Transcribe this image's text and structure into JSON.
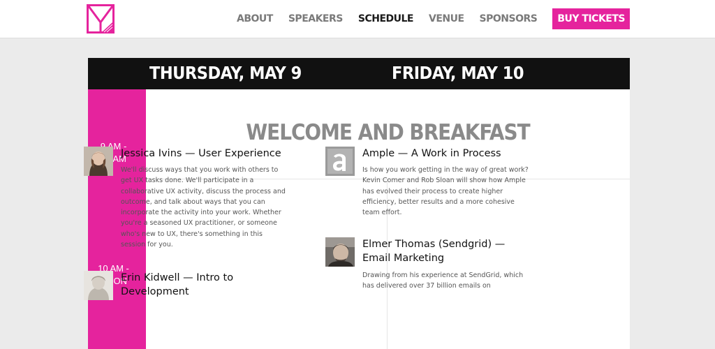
{
  "nav": {
    "items": [
      "ABOUT",
      "SPEAKERS",
      "SCHEDULE",
      "VENUE",
      "SPONSORS"
    ],
    "active": "SCHEDULE",
    "cta": "BUY TICKETS"
  },
  "colors": {
    "accent": "#e5239d",
    "header_black": "#111111",
    "muted_heading": "#8a8a8a"
  },
  "icons": {
    "logo": "m-monogram-logo-icon"
  },
  "schedule": {
    "days": [
      "THURSDAY, MAY 9",
      "FRIDAY, MAY 10"
    ],
    "slots": [
      {
        "line1": "9 AM -",
        "line2": "10 AM"
      },
      {
        "line1": "10 AM -",
        "line2": "NOON"
      }
    ],
    "welcome": "WELCOME AND BREAKFAST",
    "sessions": [
      {
        "title": "Jessica Ivins — User Experience",
        "description": "We'll discuss ways that you work with others to get UX tasks done. We'll participate in a collaborative UX activity, discuss the process and outcome, and talk about ways that you can incorporate the activity into your work. Whether you're a seasoned UX practitioner, or someone who's new to UX, there's something in this session for you."
      },
      {
        "title": "Erin Kidwell — Intro to Development",
        "description": ""
      },
      {
        "title": "Ample — A Work in Process",
        "description": "Is how you work getting in the way of great work? Kevin Comer and Rob Sloan will show how Ample has evolved their process to create higher efficiency, better results and a more cohesive team effort."
      },
      {
        "title": "Elmer Thomas (Sendgrid) — Email Marketing",
        "description": "Drawing from his experience at SendGrid, which has delivered over 37 billion emails on"
      }
    ]
  }
}
